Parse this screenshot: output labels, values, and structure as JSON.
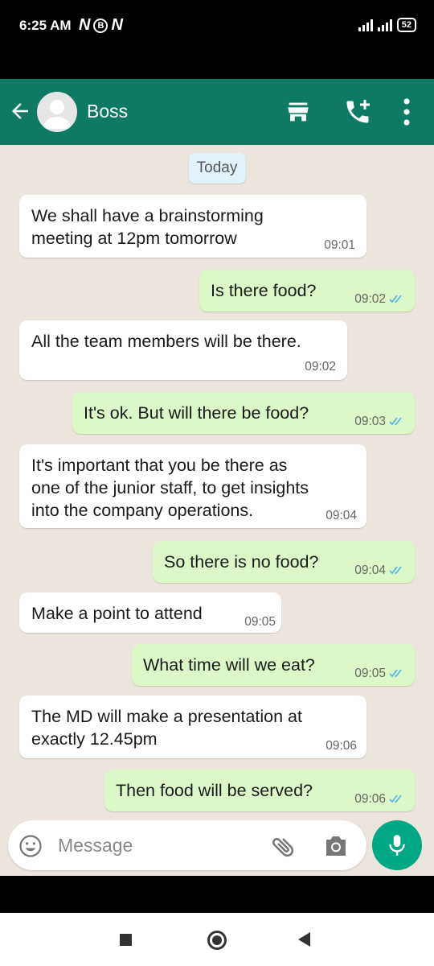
{
  "status_bar": {
    "time": "6:25 AM",
    "left_icons": [
      "N",
      "B",
      "N"
    ],
    "battery": "52"
  },
  "header": {
    "contact_name": "Boss",
    "icons": [
      "back-arrow-icon",
      "avatar",
      "shop-icon",
      "add-call-icon",
      "more-vert-icon"
    ],
    "color": "#0e7a64"
  },
  "chat": {
    "date_chip": "Today",
    "messages": [
      {
        "direction": "incoming",
        "lines": [
          "We shall have a brainstorming",
          "meeting at 12pm tomorrow"
        ],
        "time": "09:01"
      },
      {
        "direction": "outgoing",
        "lines": [
          "Is there food?"
        ],
        "time": "09:02",
        "ticks": "read"
      },
      {
        "direction": "incoming",
        "lines": [
          "All the team members will be there."
        ],
        "time": "09:02"
      },
      {
        "direction": "outgoing",
        "lines": [
          "It's ok. But will there be food?"
        ],
        "time": "09:03",
        "ticks": "read"
      },
      {
        "direction": "incoming",
        "lines": [
          "It's important that you be there as",
          "one of the junior staff, to get insights",
          "into the company operations."
        ],
        "time": "09:04"
      },
      {
        "direction": "outgoing",
        "lines": [
          "So there is no food?"
        ],
        "time": "09:04",
        "ticks": "read"
      },
      {
        "direction": "incoming",
        "lines": [
          "Make a point to attend"
        ],
        "time": "09:05"
      },
      {
        "direction": "outgoing",
        "lines": [
          "What time will we eat?"
        ],
        "time": "09:05",
        "ticks": "read"
      },
      {
        "direction": "incoming",
        "lines": [
          "The MD will make a presentation at",
          "exactly 12.45pm"
        ],
        "time": "09:06"
      },
      {
        "direction": "outgoing",
        "lines": [
          "Then food will be served?"
        ],
        "time": "09:06",
        "ticks": "read"
      }
    ]
  },
  "composer": {
    "placeholder": "Message",
    "icons": [
      "emoji-icon",
      "attach-icon",
      "camera-icon",
      "mic-icon"
    ]
  },
  "colors": {
    "incoming_bubble": "#ffffff",
    "outgoing_bubble": "#dcf8c6",
    "chat_background": "#ece5dd",
    "read_ticks": "#4fb6ec",
    "mic_button": "#00a884"
  }
}
